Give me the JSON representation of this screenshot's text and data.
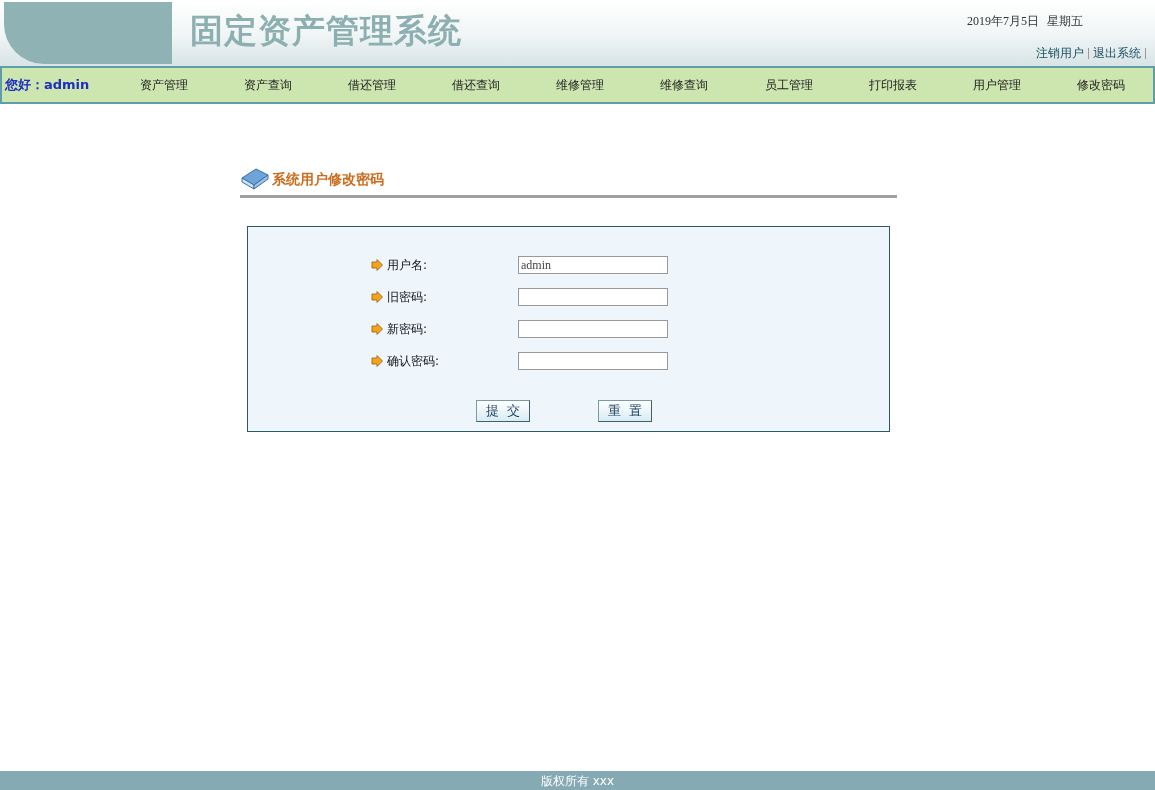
{
  "header": {
    "title": "固定资产管理系统",
    "date": "2019年7月5日",
    "weekday": "星期五",
    "links": [
      "注销用户",
      "退出系统"
    ]
  },
  "nav": {
    "greeting": "您好：admin",
    "items": [
      "资产管理",
      "资产查询",
      "借还管理",
      "借还查询",
      "维修管理",
      "维修查询",
      "员工管理",
      "打印报表",
      "用户管理",
      "修改密码"
    ]
  },
  "section": {
    "title": "系统用户修改密码"
  },
  "form": {
    "fields": [
      {
        "label": "用户名:",
        "value": "admin"
      },
      {
        "label": "旧密码:"
      },
      {
        "label": "新密码:"
      },
      {
        "label": "确认密码:"
      }
    ],
    "buttons": [
      "提  交",
      "重  置"
    ]
  },
  "footer": {
    "text": "版权所有 xxx"
  }
}
